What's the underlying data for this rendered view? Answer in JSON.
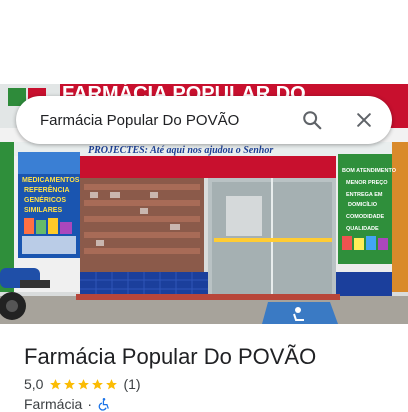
{
  "search": {
    "query": "Farmácia Popular Do POVÃO",
    "search_icon": "search-icon",
    "close_icon": "close-icon"
  },
  "photo": {
    "store_sign": "FARMÁCIA POPULAR DO",
    "awning_text": "PROJECTES: Até aqui nos ajudou o Senhor",
    "left_poster": [
      "MEDICAMENTOS",
      "REFERÊNCIA",
      "GENÉRICOS",
      "SIMILARES"
    ],
    "right_poster": [
      "BOM ATENDIMENTO",
      "MENOR PREÇO",
      "ENTREGA EM",
      "DOMICÍLIO",
      "COMODIDADE",
      "QUALIDADE"
    ]
  },
  "place": {
    "name": "Farmácia Popular Do POVÃO",
    "rating": "5,0",
    "stars": 5,
    "review_count": "(1)",
    "category": "Farmácia",
    "separator": "·",
    "accessibility_icon": "wheelchair-icon"
  },
  "colors": {
    "star": "#fbbc04",
    "accessibility": "#1a73e8",
    "sign_red": "#c8102e"
  }
}
